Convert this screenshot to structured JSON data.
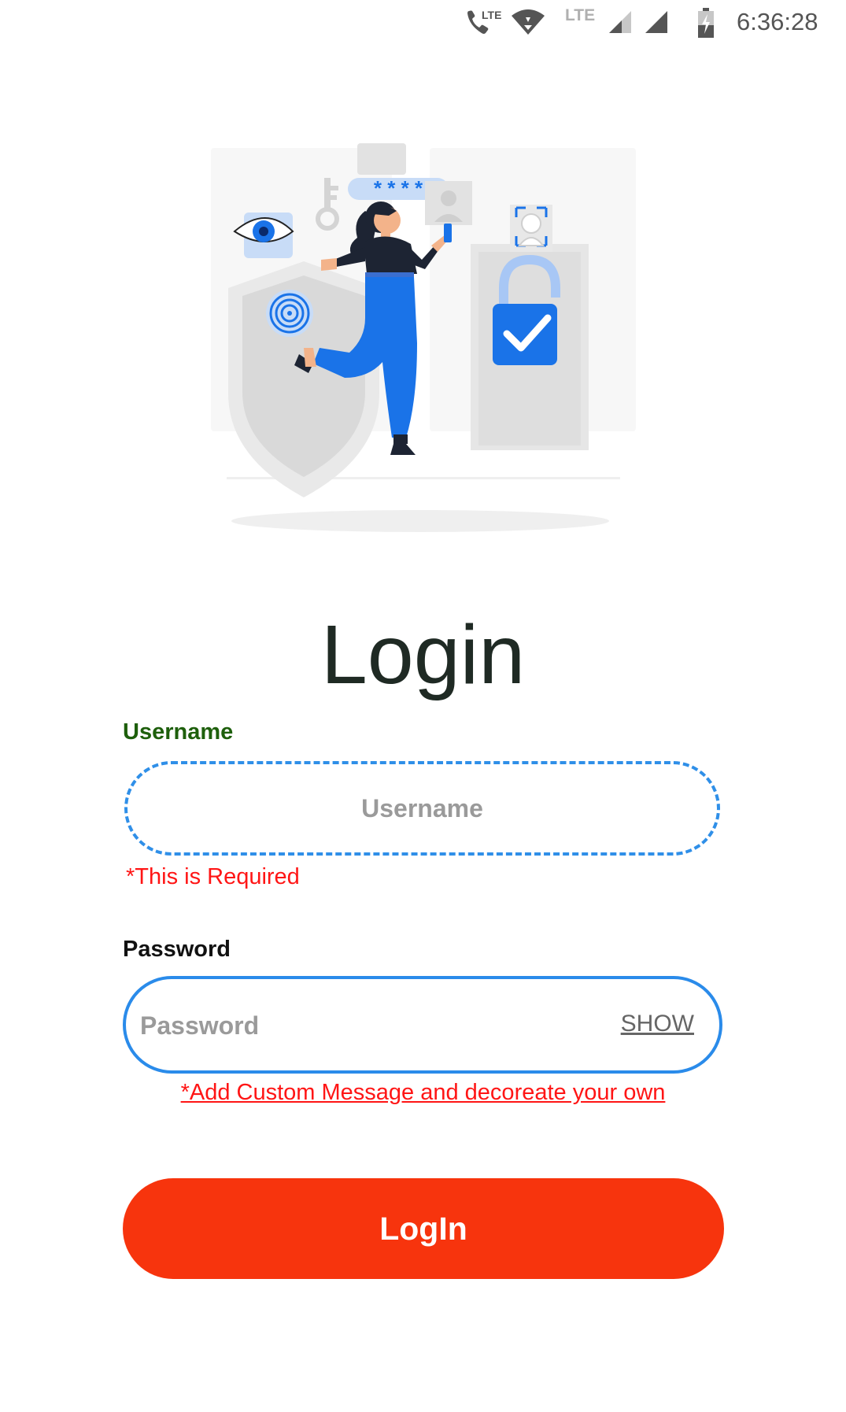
{
  "status_bar": {
    "network_label_1": "LTE",
    "network_label_2": "LTE",
    "time": "6:36:28",
    "icons": [
      "call-lte-icon",
      "wifi-icon",
      "signal-icon",
      "signal-icon",
      "battery-charging-icon"
    ]
  },
  "illustration": {
    "name": "login-security-illustration",
    "password_mask": "* * * *",
    "colors": {
      "accent": "#1a73e8",
      "light_accent": "#a8c7f5",
      "gray": "#e6e6e6"
    }
  },
  "login": {
    "title": "Login",
    "username": {
      "label": "Username",
      "placeholder": "Username",
      "value": "",
      "error": "*This is Required"
    },
    "password": {
      "label": "Password",
      "placeholder": "Password",
      "value": "",
      "toggle_label": "SHOW",
      "error": "*Add Custom Message and decoreate your own"
    },
    "submit_label": "LogIn"
  },
  "colors": {
    "username_label": "#1e5f0c",
    "input_border": "#2f8fe8",
    "error": "#ff1515",
    "button": "#f7340d",
    "title": "#1f2a24"
  }
}
